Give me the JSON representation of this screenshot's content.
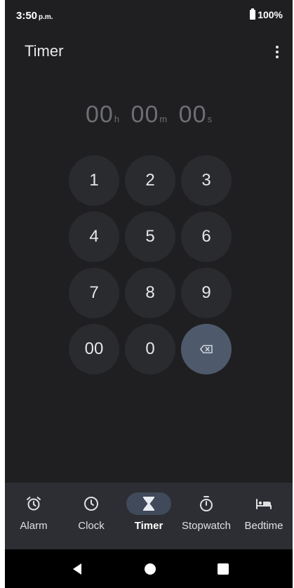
{
  "status_bar": {
    "time": "3:50",
    "time_suffix": "p.m.",
    "battery": "100%"
  },
  "app_bar": {
    "title": "Timer",
    "menu_icon": "more-vert-icon"
  },
  "timer_display": {
    "hours": "00",
    "hours_unit": "h",
    "minutes": "00",
    "minutes_unit": "m",
    "seconds": "00",
    "seconds_unit": "s"
  },
  "keypad": {
    "k1": "1",
    "k2": "2",
    "k3": "3",
    "k4": "4",
    "k5": "5",
    "k6": "6",
    "k7": "7",
    "k8": "8",
    "k9": "9",
    "k00": "00",
    "k0": "0",
    "backspace_icon": "backspace-icon"
  },
  "bottom_nav": {
    "items": [
      {
        "label": "Alarm",
        "icon": "alarm-icon",
        "active": false
      },
      {
        "label": "Clock",
        "icon": "clock-icon",
        "active": false
      },
      {
        "label": "Timer",
        "icon": "hourglass-icon",
        "active": true
      },
      {
        "label": "Stopwatch",
        "icon": "stopwatch-icon",
        "active": false
      },
      {
        "label": "Bedtime",
        "icon": "bed-icon",
        "active": false
      }
    ]
  },
  "colors": {
    "background": "#1f1f21",
    "key_background": "#2a2b2f",
    "backspace_key": "#4e5a6c",
    "nav_background": "#2c2e33",
    "active_pill": "#414a5a",
    "display_digits": "#6d6f74"
  }
}
